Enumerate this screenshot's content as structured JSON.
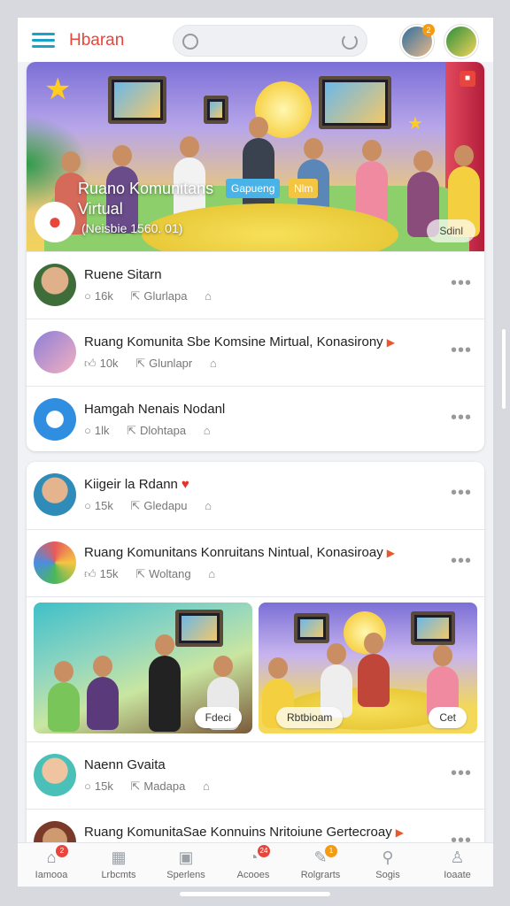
{
  "header": {
    "title": "Hbaran",
    "notification_count": "2"
  },
  "hero": {
    "title": "Ruano Komunitans Virtual",
    "subtitle": "(Neisbie 1560. 01)",
    "tag_1": "Gapueng",
    "tag_2": "Nlm",
    "button_label": "Sdinl"
  },
  "feed_1": [
    {
      "title": "Ruene Sitarn",
      "count": "16k",
      "share": "Glurlapa",
      "title_suffix": ""
    },
    {
      "title": "Ruang Komunita Sbe Komsine Mirtual, Konasirony",
      "count": "10k",
      "share": "Glunlapr",
      "title_suffix": "▶"
    },
    {
      "title": "Hamgah Nenais Nodanl",
      "count": "1lk",
      "share": "Dlohtapa",
      "title_suffix": ""
    }
  ],
  "feed_2": [
    {
      "title": "Kiigeir la Rdann",
      "count": "15k",
      "share": "Gledapu",
      "title_suffix": "♥"
    },
    {
      "title": "Ruang Komunitans Konruitans Nintual, Konasiroay",
      "count": "15k",
      "share": "Woltang",
      "title_suffix": "▶"
    }
  ],
  "tiles": [
    {
      "button": "Fdeci"
    },
    {
      "button_left": "Rbtbioam",
      "button_right": "Cet"
    }
  ],
  "feed_3": [
    {
      "title": "Naenn Gvaita",
      "count": "15k",
      "share": "Madapa",
      "title_suffix": ""
    },
    {
      "title": "Ruang KomunitaSae Konnuins Nritoiune Gertecroay",
      "count": "",
      "share": "",
      "title_suffix": "▶"
    }
  ],
  "tabbar": [
    {
      "label": "Iamooa",
      "icon": "home-icon",
      "badge": "2"
    },
    {
      "label": "Lrbcmts",
      "icon": "calendar-icon",
      "badge": ""
    },
    {
      "label": "Sperlens",
      "icon": "image-icon",
      "badge": ""
    },
    {
      "label": "Acooes",
      "icon": "chat-icon",
      "badge": "24"
    },
    {
      "label": "Rolgrarts",
      "icon": "edit-icon",
      "badge": "1"
    },
    {
      "label": "Sogis",
      "icon": "search-icon",
      "badge": ""
    },
    {
      "label": "Ioaate",
      "icon": "profile-icon",
      "badge": ""
    }
  ],
  "colors": {
    "accent": "#e8453c",
    "teal": "#1aa3c9",
    "badge_orange": "#f39c12"
  }
}
